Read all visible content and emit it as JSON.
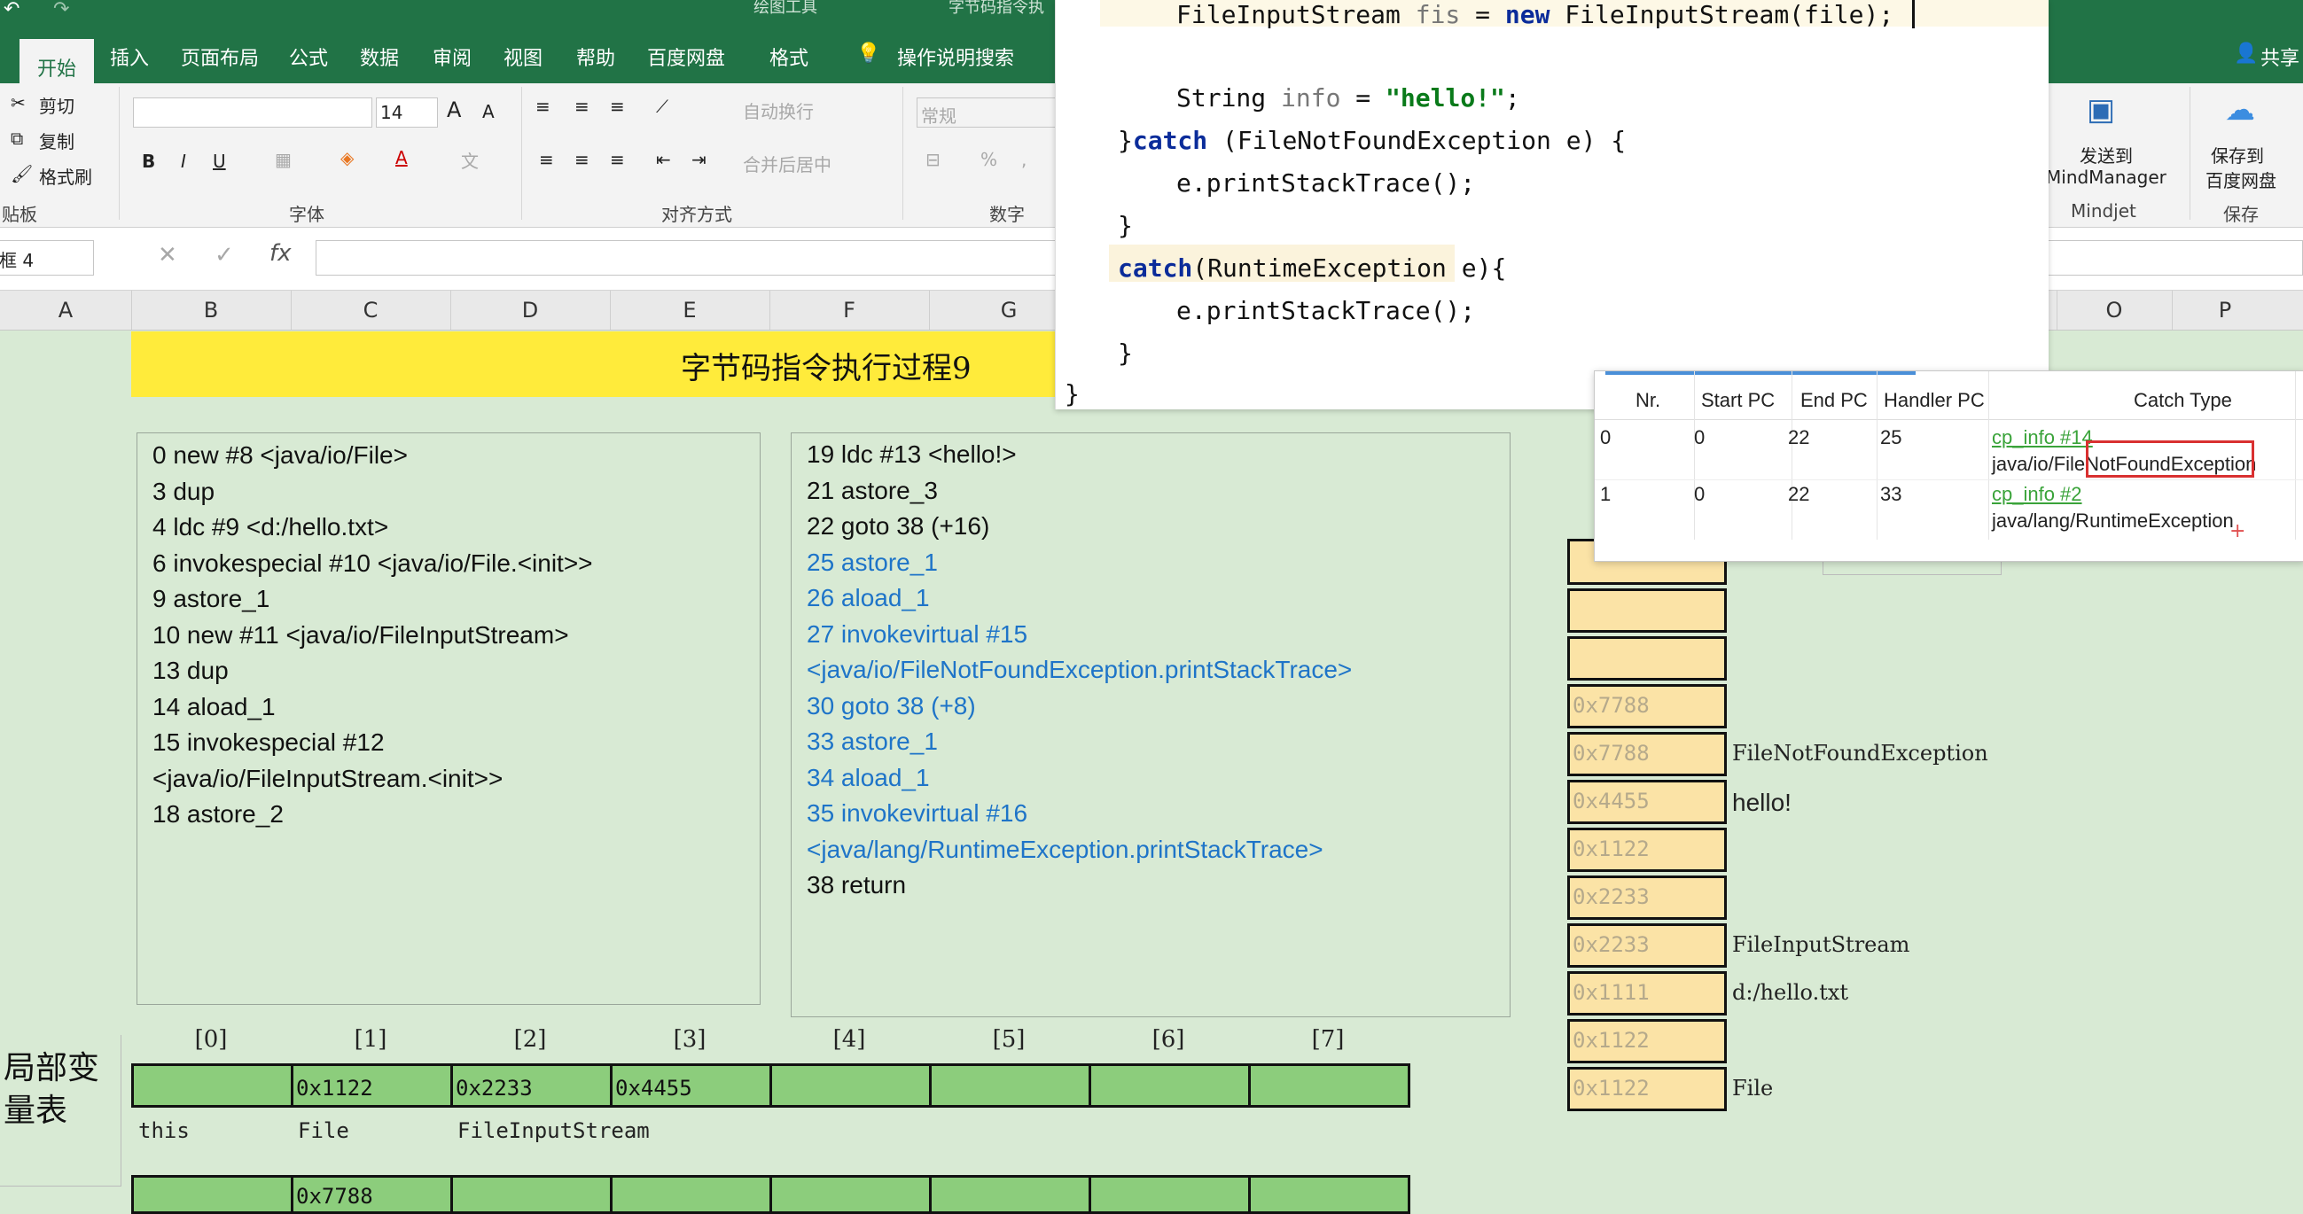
{
  "ribbon": {
    "title_text": "绘图工具",
    "doc_title": "字节码指令执",
    "tabs": [
      "开始",
      "插入",
      "页面布局",
      "公式",
      "数据",
      "审阅",
      "视图",
      "帮助",
      "百度网盘",
      "格式"
    ],
    "active_tab": "开始",
    "tell_me": "操作说明搜索",
    "share": "共享",
    "clipboard": {
      "cut": "剪切",
      "copy": "复制",
      "format_painter": "格式刷",
      "group": "贴板"
    },
    "font": {
      "size": "14",
      "bold": "B",
      "italic": "I",
      "underline": "U",
      "grow": "A",
      "shrink": "A",
      "group": "字体"
    },
    "alignment": {
      "wrap": "自动换行",
      "merge": "合并后居中",
      "group": "对齐方式"
    },
    "number": {
      "format": "常规",
      "percent": "%",
      "comma": ",",
      "group": "数字"
    },
    "mindjet": {
      "send": "发送到",
      "app": "MindManager",
      "group": "Mindjet"
    },
    "baidu": {
      "save": "保存到",
      "target": "百度网盘",
      "group": "保存"
    }
  },
  "formula_bar": {
    "name_box": "框 4",
    "cancel": "✕",
    "enter": "✓",
    "fx": "fx",
    "value": ""
  },
  "columns": [
    "A",
    "B",
    "C",
    "D",
    "E",
    "F",
    "G",
    "O",
    "P"
  ],
  "sheet": {
    "banner_title": "字节码指令执行过程9",
    "left_code": [
      {
        "text": " 0 new #8 <java/io/File>",
        "color": "black"
      },
      {
        "text": " 3 dup",
        "color": "black"
      },
      {
        "text": " 4 ldc #9 <d:/hello.txt>",
        "color": "black"
      },
      {
        "text": " 6 invokespecial #10 <java/io/File.<init>>",
        "color": "black"
      },
      {
        "text": " 9 astore_1",
        "color": "black"
      },
      {
        "text": "10 new #11 <java/io/FileInputStream>",
        "color": "black"
      },
      {
        "text": "13 dup",
        "color": "black"
      },
      {
        "text": "14 aload_1",
        "color": "black"
      },
      {
        "text": "15 invokespecial #12",
        "color": "black"
      },
      {
        "text": "<java/io/FileInputStream.<init>>",
        "color": "black"
      },
      {
        "text": "18 astore_2",
        "color": "black"
      }
    ],
    "right_code": [
      {
        "text": "19 ldc #13 <hello!>",
        "color": "black"
      },
      {
        "text": "21 astore_3",
        "color": "black"
      },
      {
        "text": "22 goto 38 (+16)",
        "color": "black"
      },
      {
        "text": "25 astore_1",
        "color": "blue"
      },
      {
        "text": "26 aload_1",
        "color": "blue"
      },
      {
        "text": "27 invokevirtual #15",
        "color": "blue"
      },
      {
        "text": "<java/io/FileNotFoundException.printStackTrace>",
        "color": "blue"
      },
      {
        "text": "30 goto 38 (+8)",
        "color": "blue"
      },
      {
        "text": "33 astore_1",
        "color": "blue"
      },
      {
        "text": "34 aload_1",
        "color": "blue"
      },
      {
        "text": "35 invokevirtual #16",
        "color": "blue"
      },
      {
        "text": "<java/lang/RuntimeException.printStackTrace>",
        "color": "blue"
      },
      {
        "text": "38 return",
        "color": "black"
      }
    ],
    "stack": [
      {
        "addr": "",
        "label": ""
      },
      {
        "addr": "",
        "label": ""
      },
      {
        "addr": "0x7788",
        "label": ""
      },
      {
        "addr": "0x7788",
        "label": "FileNotFoundException"
      },
      {
        "addr": "0x4455",
        "label": "hello!"
      },
      {
        "addr": "0x1122",
        "label": ""
      },
      {
        "addr": "0x2233",
        "label": ""
      },
      {
        "addr": "0x2233",
        "label": "FileInputStream"
      },
      {
        "addr": "0x1111",
        "label": "d:/hello.txt"
      },
      {
        "addr": "0x1122",
        "label": ""
      },
      {
        "addr": "0x1122",
        "label": "File"
      }
    ],
    "local_var_title": "局部变量表",
    "local_var_indices": [
      "[0]",
      "[1]",
      "[2]",
      "[3]",
      "[4]",
      "[5]",
      "[6]",
      "[7]"
    ],
    "local_var_values": [
      "",
      "0x1122",
      "0x2233",
      "0x4455",
      "",
      "",
      "",
      ""
    ],
    "local_var_names": [
      "this",
      "File",
      "FileInputStream",
      "",
      "",
      "",
      "",
      ""
    ],
    "local_var_values_row2": [
      "",
      "0x7788",
      "",
      "",
      "",
      "",
      "",
      ""
    ]
  },
  "ide": {
    "lines": [
      {
        "parts": [
          {
            "t": "FileInputStream ",
            "c": ""
          },
          {
            "t": "fis",
            "c": "var"
          },
          {
            "t": " = ",
            "c": ""
          },
          {
            "t": "new",
            "c": "kw"
          },
          {
            "t": " FileInputStream(file);",
            "c": ""
          }
        ]
      },
      {
        "parts": []
      },
      {
        "parts": [
          {
            "t": "String ",
            "c": ""
          },
          {
            "t": "info",
            "c": "var"
          },
          {
            "t": " = ",
            "c": ""
          },
          {
            "t": "\"hello!\"",
            "c": "str"
          },
          {
            "t": ";",
            "c": ""
          }
        ]
      },
      {
        "parts": [
          {
            "t": "}",
            "c": ""
          },
          {
            "t": "catch",
            "c": "kw"
          },
          {
            "t": " (FileNotFoundException e) {",
            "c": ""
          }
        ]
      },
      {
        "parts": [
          {
            "t": "e.printStackTrace();",
            "c": ""
          }
        ]
      },
      {
        "parts": [
          {
            "t": "}",
            "c": ""
          }
        ]
      },
      {
        "parts": [
          {
            "t": "catch",
            "c": "kw"
          },
          {
            "t": "(RuntimeException e){",
            "c": ""
          }
        ]
      },
      {
        "parts": [
          {
            "t": "e.printStackTrace();",
            "c": ""
          }
        ]
      },
      {
        "parts": [
          {
            "t": "}",
            "c": ""
          }
        ]
      },
      {
        "parts": [
          {
            "t": "}",
            "c": ""
          }
        ]
      }
    ]
  },
  "exception_table": {
    "headers": [
      "Nr.",
      "Start PC",
      "End PC",
      "Handler PC",
      "Catch Type"
    ],
    "rows": [
      {
        "nr": "0",
        "start": "0",
        "end": "22",
        "handler": "25",
        "ref": "cp_info #14",
        "type": "java/io/FileNotFoundException"
      },
      {
        "nr": "1",
        "start": "0",
        "end": "22",
        "handler": "33",
        "ref": "cp_info #2",
        "type": "java/lang/RuntimeException"
      }
    ]
  },
  "colors": {
    "excel_green": "#217346",
    "banner": "#ffeb3b",
    "stack_cell": "#fbe3a6",
    "lv_cell": "#8ccd7c",
    "bytecode_blue": "#1e74c8"
  }
}
